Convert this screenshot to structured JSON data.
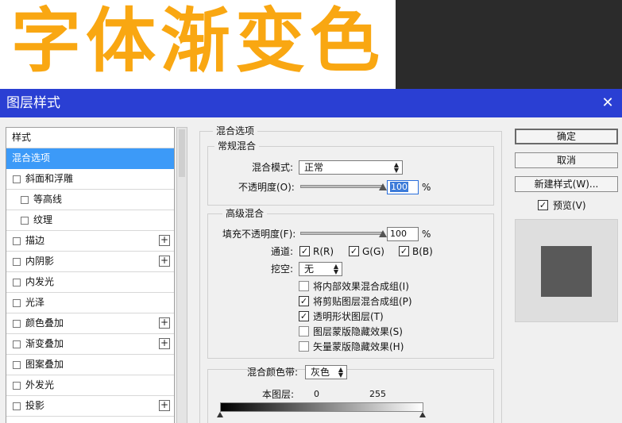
{
  "banner": {
    "text": "字体渐变色",
    "color": "#f9a712"
  },
  "dialog": {
    "title": "图层样式"
  },
  "style_list": {
    "items": [
      {
        "label": "样式",
        "has_checkbox": false,
        "has_plus": false,
        "indent": 0
      },
      {
        "label": "混合选项",
        "has_checkbox": false,
        "has_plus": false,
        "indent": 0,
        "selected": true
      },
      {
        "label": "斜面和浮雕",
        "has_checkbox": true,
        "has_plus": false,
        "indent": 0
      },
      {
        "label": "等高线",
        "has_checkbox": true,
        "has_plus": false,
        "indent": 1
      },
      {
        "label": "纹理",
        "has_checkbox": true,
        "has_plus": false,
        "indent": 1
      },
      {
        "label": "描边",
        "has_checkbox": true,
        "has_plus": true,
        "indent": 0
      },
      {
        "label": "内阴影",
        "has_checkbox": true,
        "has_plus": true,
        "indent": 0
      },
      {
        "label": "内发光",
        "has_checkbox": true,
        "has_plus": false,
        "indent": 0
      },
      {
        "label": "光泽",
        "has_checkbox": true,
        "has_plus": false,
        "indent": 0
      },
      {
        "label": "颜色叠加",
        "has_checkbox": true,
        "has_plus": true,
        "indent": 0
      },
      {
        "label": "渐变叠加",
        "has_checkbox": true,
        "has_plus": true,
        "indent": 0
      },
      {
        "label": "图案叠加",
        "has_checkbox": true,
        "has_plus": false,
        "indent": 0
      },
      {
        "label": "外发光",
        "has_checkbox": true,
        "has_plus": false,
        "indent": 0
      },
      {
        "label": "投影",
        "has_checkbox": true,
        "has_plus": true,
        "indent": 0
      }
    ]
  },
  "blending_options": {
    "group_label": "混合选项",
    "general": {
      "group_label": "常规混合",
      "mode_label": "混合模式:",
      "mode_value": "正常",
      "opacity_label": "不透明度(O):",
      "opacity_value": "100",
      "opacity_level": 1.0,
      "percent": "%"
    },
    "advanced": {
      "group_label": "高级混合",
      "fill_label": "填充不透明度(F):",
      "fill_value": "100",
      "fill_level": 1.0,
      "percent": "%",
      "channels_label": "通道:",
      "channel_r": "R(R)",
      "channel_g": "G(G)",
      "channel_b": "B(B)",
      "knockout_label": "挖空:",
      "knockout_value": "无",
      "options": [
        {
          "label": "将内部效果混合成组(I)",
          "checked": false
        },
        {
          "label": "将剪贴图层混合成组(P)",
          "checked": true
        },
        {
          "label": "透明形状图层(T)",
          "checked": true
        },
        {
          "label": "图层蒙版隐藏效果(S)",
          "checked": false
        },
        {
          "label": "矢量蒙版隐藏效果(H)",
          "checked": false
        }
      ]
    },
    "blend_if": {
      "label": "混合颜色带:",
      "value": "灰色",
      "this_layer_label": "本图层:",
      "low": "0",
      "high": "255"
    }
  },
  "buttons": {
    "ok": "确定",
    "cancel": "取消",
    "new_style": "新建样式(W)...",
    "preview_label": "预览(V)",
    "preview_checked": true
  },
  "colors": {
    "titlebar": "#2a3fd3",
    "selection": "#3c9af8",
    "preview_swatch": "#595959"
  }
}
